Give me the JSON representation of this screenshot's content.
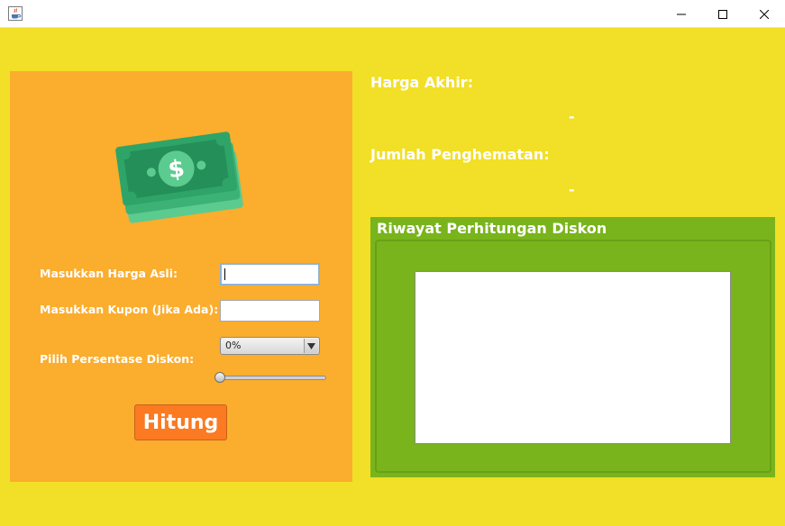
{
  "window": {
    "icon": "java-cup-icon",
    "controls": [
      "minimize-icon",
      "maximize-icon",
      "close-icon"
    ]
  },
  "colors": {
    "background": "#f2df27",
    "left_panel": "#fbad2d",
    "history_panel": "#79b41c",
    "button": "#fb7a22"
  },
  "form": {
    "money_icon": "money-bills-icon",
    "harga_label": "Masukkan Harga Asli:",
    "harga_value": "",
    "kupon_label": "Masukkan Kupon (Jika Ada):",
    "kupon_value": "",
    "diskon_label": "Pilih Persentase Diskon:",
    "diskon_selected": "0%",
    "diskon_slider_value": 0,
    "hitung_label": "Hitung"
  },
  "result": {
    "harga_akhir_label": "Harga Akhir:",
    "harga_akhir_value": "-",
    "penghematan_label": "Jumlah Penghematan:",
    "penghematan_value": "-"
  },
  "history": {
    "title": "Riwayat Perhitungan Diskon",
    "content": ""
  }
}
